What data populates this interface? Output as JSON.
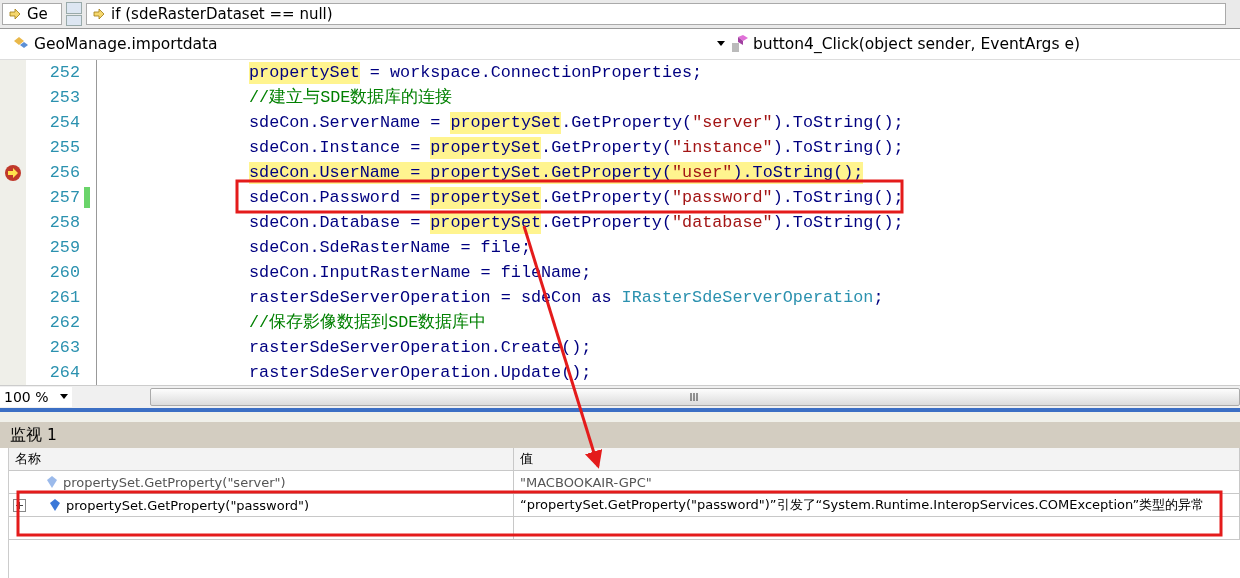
{
  "navigation_bar": {
    "type_combo": "Ge",
    "member_combo": "if (sdeRasterDataset == null)"
  },
  "class_bar": {
    "class_name": "GeoManage.importdata",
    "member_name": "button4_Click(object sender, EventArgs e)"
  },
  "editor": {
    "lines": [
      {
        "number": "252",
        "current": false,
        "changed": false,
        "segments": [
          {
            "kind": "ref",
            "text": "propertySet"
          },
          {
            "kind": "text",
            "text": " = workspace.ConnectionProperties;"
          }
        ]
      },
      {
        "number": "253",
        "current": false,
        "changed": false,
        "segments": [
          {
            "kind": "comment",
            "text": "//建立与SDE数据库的连接"
          }
        ]
      },
      {
        "number": "254",
        "current": false,
        "changed": false,
        "segments": [
          {
            "kind": "text",
            "text": "sdeCon.ServerName = "
          },
          {
            "kind": "ref",
            "text": "propertySet"
          },
          {
            "kind": "text",
            "text": ".GetProperty("
          },
          {
            "kind": "string",
            "text": "\"server\""
          },
          {
            "kind": "text",
            "text": ").ToString();"
          }
        ]
      },
      {
        "number": "255",
        "current": false,
        "changed": false,
        "segments": [
          {
            "kind": "text",
            "text": "sdeCon.Instance = "
          },
          {
            "kind": "ref",
            "text": "propertySet"
          },
          {
            "kind": "text",
            "text": ".GetProperty("
          },
          {
            "kind": "string",
            "text": "\"instance\""
          },
          {
            "kind": "text",
            "text": ").ToString();"
          }
        ]
      },
      {
        "number": "256",
        "current": true,
        "changed": false,
        "segments": [
          {
            "kind": "text",
            "text": "sdeCon.UserName = "
          },
          {
            "kind": "ref",
            "text": "propertySet"
          },
          {
            "kind": "text",
            "text": ".GetProperty("
          },
          {
            "kind": "string",
            "text": "\"user\""
          },
          {
            "kind": "text",
            "text": ").ToString();"
          }
        ]
      },
      {
        "number": "257",
        "current": false,
        "changed": true,
        "segments": [
          {
            "kind": "text",
            "text": "sdeCon.Password = "
          },
          {
            "kind": "ref",
            "text": "propertySet"
          },
          {
            "kind": "text",
            "text": ".GetProperty("
          },
          {
            "kind": "string",
            "text": "\"password\""
          },
          {
            "kind": "text",
            "text": ").ToString();"
          }
        ]
      },
      {
        "number": "258",
        "current": false,
        "changed": false,
        "segments": [
          {
            "kind": "text",
            "text": "sdeCon.Database = "
          },
          {
            "kind": "ref",
            "text": "propertySet"
          },
          {
            "kind": "text",
            "text": ".GetProperty("
          },
          {
            "kind": "string",
            "text": "\"database\""
          },
          {
            "kind": "text",
            "text": ").ToString();"
          }
        ]
      },
      {
        "number": "259",
        "current": false,
        "changed": false,
        "segments": [
          {
            "kind": "text",
            "text": "sdeCon.SdeRasterName = file;"
          }
        ]
      },
      {
        "number": "260",
        "current": false,
        "changed": false,
        "segments": [
          {
            "kind": "text",
            "text": "sdeCon.InputRasterName = fileName;"
          }
        ]
      },
      {
        "number": "261",
        "current": false,
        "changed": false,
        "segments": [
          {
            "kind": "text",
            "text": "rasterSdeServerOperation = sdeCon as "
          },
          {
            "kind": "type",
            "text": "IRasterSdeServerOperation"
          },
          {
            "kind": "text",
            "text": ";"
          }
        ]
      },
      {
        "number": "262",
        "current": false,
        "changed": false,
        "segments": [
          {
            "kind": "comment",
            "text": "//保存影像数据到SDE数据库中"
          }
        ]
      },
      {
        "number": "263",
        "current": false,
        "changed": false,
        "segments": [
          {
            "kind": "text",
            "text": "rasterSdeServerOperation.Create();"
          }
        ]
      },
      {
        "number": "264",
        "current": false,
        "changed": false,
        "segments": [
          {
            "kind": "text",
            "text": "rasterSdeServerOperation.Update();"
          }
        ]
      }
    ]
  },
  "zoom": "100 %",
  "watch": {
    "title": "监视 1",
    "columns": [
      "名称",
      "值"
    ],
    "rows": [
      {
        "name": "propertySet.GetProperty(\"server\")",
        "value": "\"MACBOOKAIR-GPC\"",
        "stale": true,
        "expandable": false
      },
      {
        "name": "propertySet.GetProperty(\"password\")",
        "value": "“propertySet.GetProperty(\"password\")”引发了“System.Runtime.InteropServices.COMException”类型的异常",
        "stale": false,
        "expandable": true
      }
    ]
  }
}
